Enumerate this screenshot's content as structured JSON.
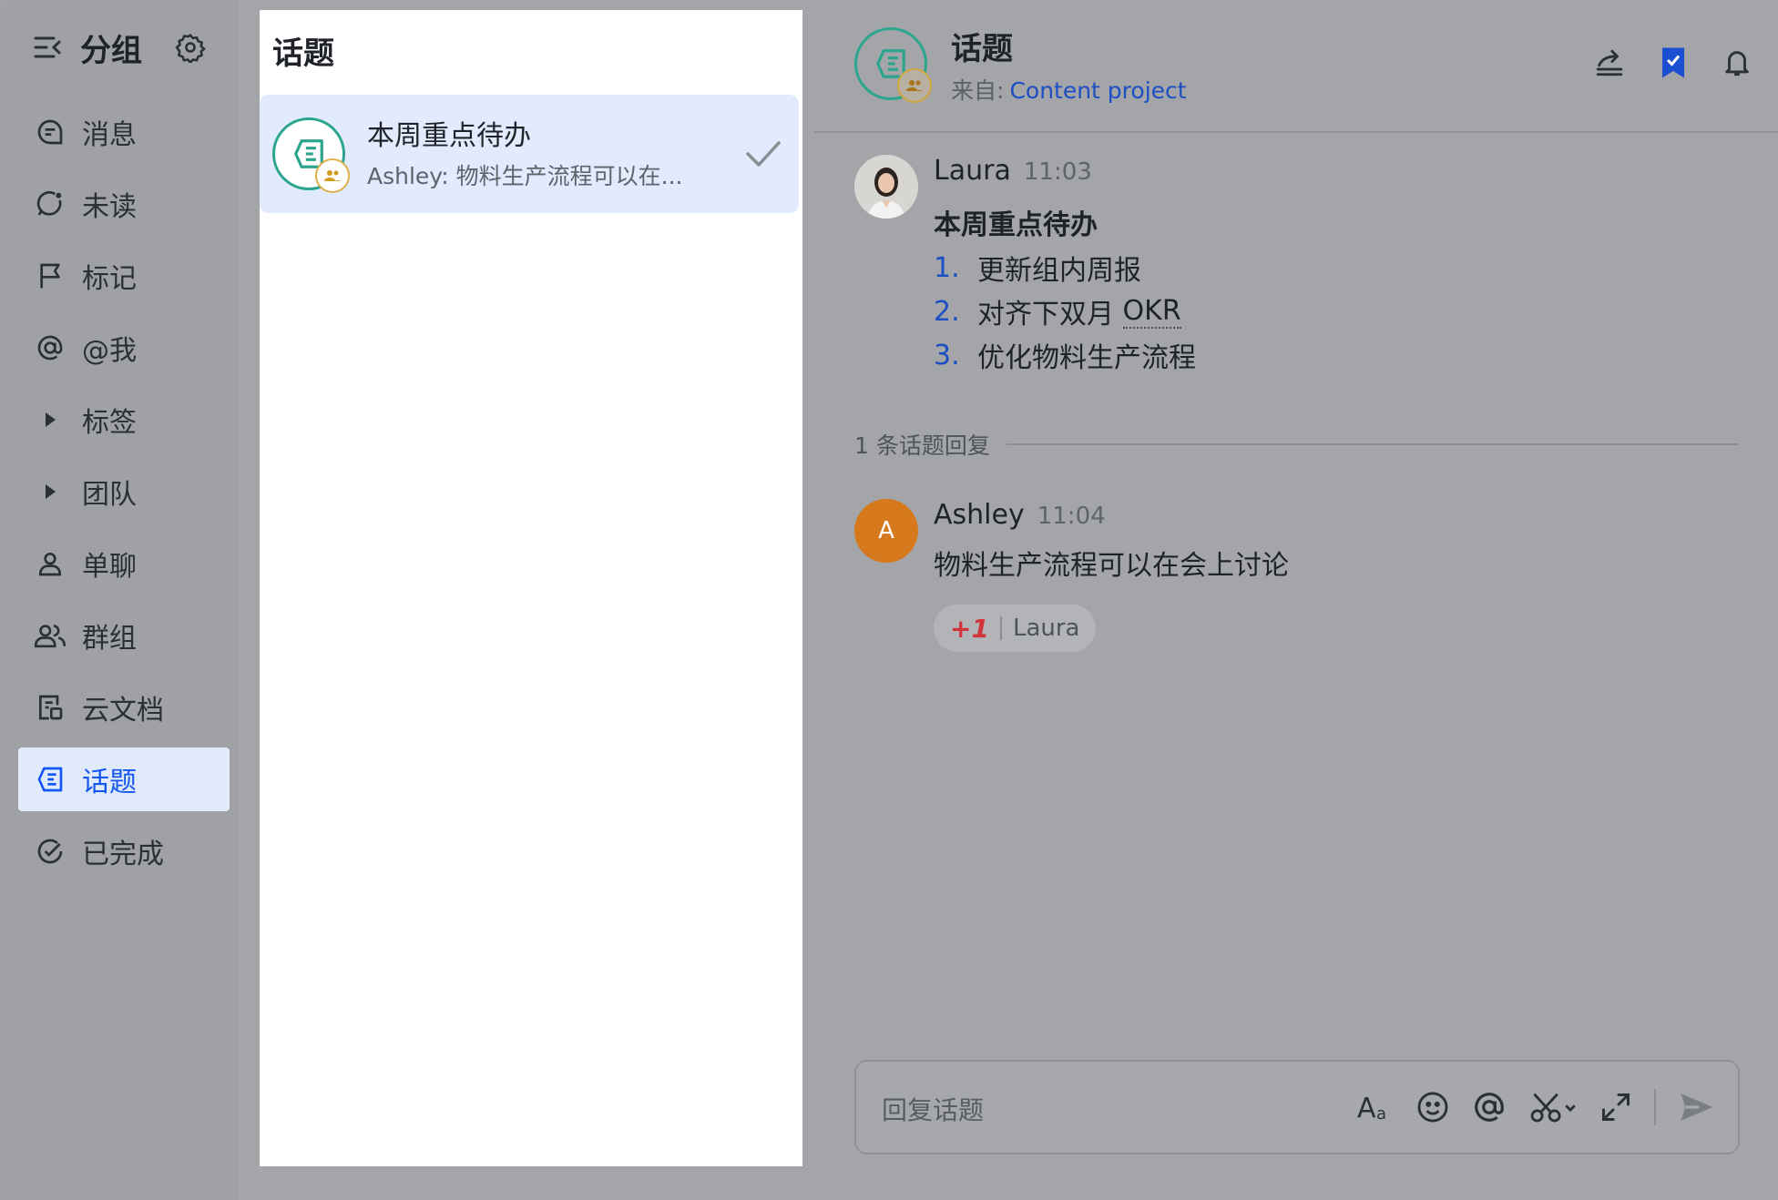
{
  "sidebar": {
    "title": "分组",
    "items": [
      {
        "label": "消息",
        "icon": "message-icon"
      },
      {
        "label": "未读",
        "icon": "unread-icon"
      },
      {
        "label": "标记",
        "icon": "flag-icon"
      },
      {
        "label": "@我",
        "icon": "at-icon"
      },
      {
        "label": "标签",
        "icon": "caret-right-icon"
      },
      {
        "label": "团队",
        "icon": "caret-right-icon"
      },
      {
        "label": "单聊",
        "icon": "person-icon"
      },
      {
        "label": "群组",
        "icon": "group-icon"
      },
      {
        "label": "云文档",
        "icon": "doc-icon"
      },
      {
        "label": "话题",
        "icon": "topic-icon"
      },
      {
        "label": "已完成",
        "icon": "done-icon"
      }
    ],
    "active_index": 9
  },
  "list": {
    "title": "话题",
    "topics": [
      {
        "name": "本周重点待办",
        "preview": "Ashley: 物料生产流程可以在..."
      }
    ]
  },
  "detail": {
    "title": "话题",
    "from_label": "来自:",
    "from_source": "Content project",
    "messages": [
      {
        "author": "Laura",
        "time": "11:03",
        "heading": "本周重点待办",
        "items": [
          {
            "num": "1.",
            "text": "更新组内周报"
          },
          {
            "num": "2.",
            "text": "对齐下双月 ",
            "tail": "OKR"
          },
          {
            "num": "3.",
            "text": "优化物料生产流程"
          }
        ]
      }
    ],
    "replies_label": "1 条话题回复",
    "replies": [
      {
        "author": "Ashley",
        "avatar_letter": "A",
        "time": "11:04",
        "text": "物料生产流程可以在会上讨论",
        "reaction": {
          "emoji": "+1",
          "users": "Laura"
        }
      }
    ],
    "composer": {
      "placeholder": "回复话题"
    }
  },
  "colors": {
    "accent": "#1456f0",
    "topic_green": "#2ca58e",
    "badge_gold": "#e0b24c",
    "link_blue": "#1d4fc4"
  }
}
